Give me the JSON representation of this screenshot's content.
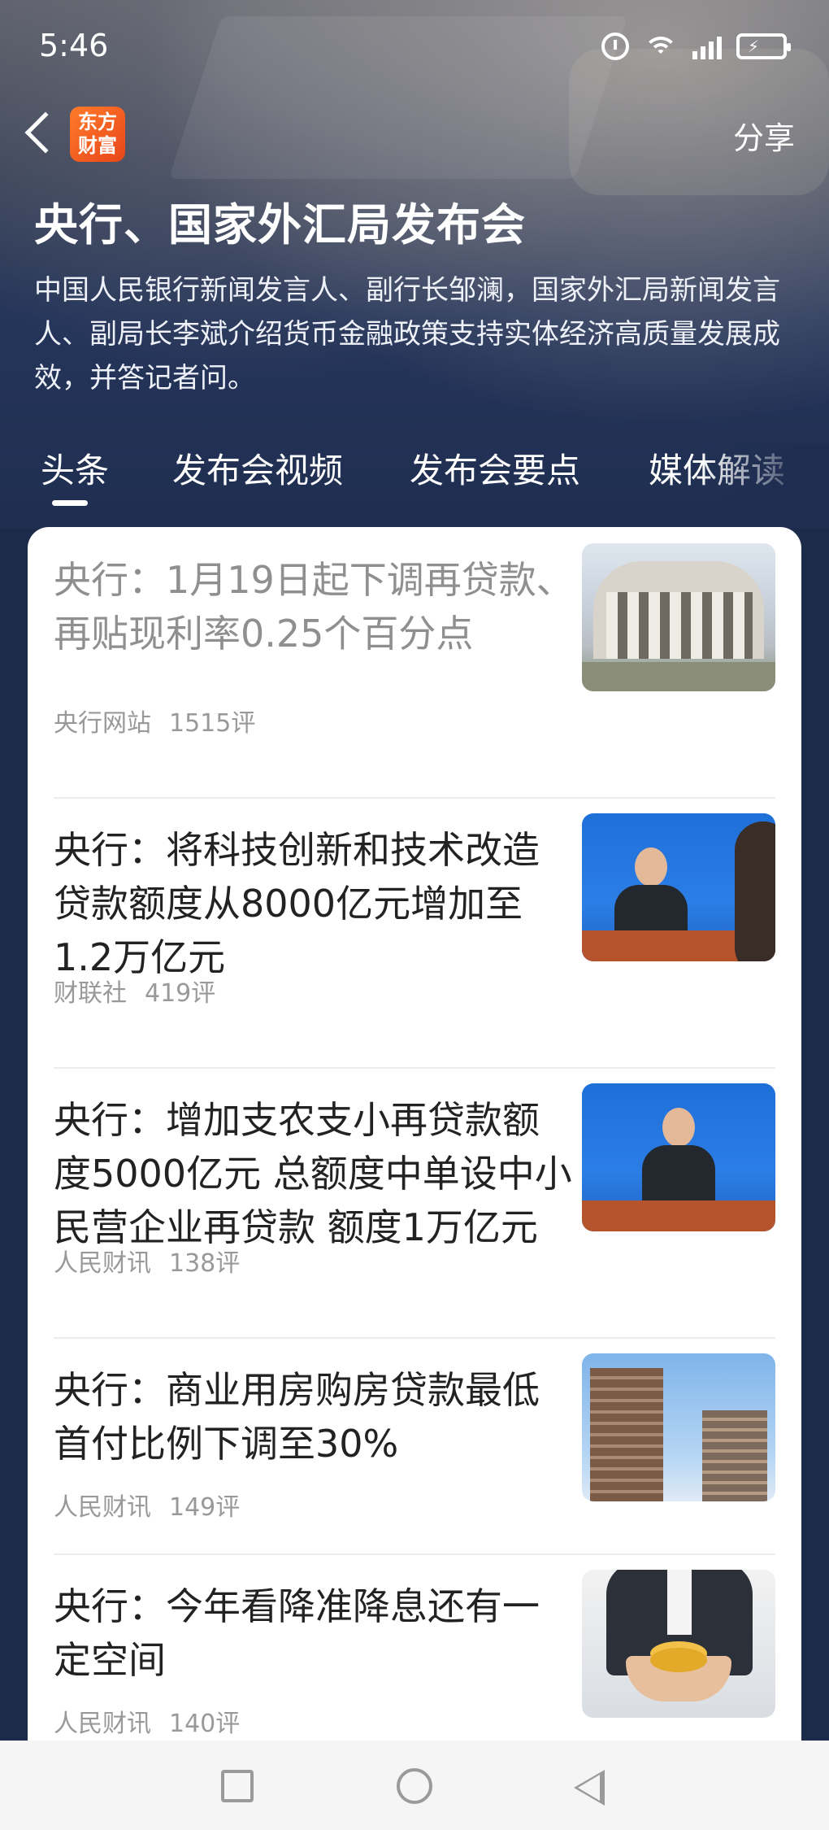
{
  "status_bar": {
    "time": "5:46"
  },
  "nav": {
    "logo_line1": "东方",
    "logo_line2": "财富",
    "share_label": "分享"
  },
  "header": {
    "title": "央行、国家外汇局发布会",
    "description": "中国人民银行新闻发言人、副行长邹澜，国家外汇局新闻发言人、副局长李斌介绍货币金融政策支持实体经济高质量发展成效，并答记者问。"
  },
  "tabs": [
    {
      "label": "头条",
      "active": true
    },
    {
      "label": "发布会视频"
    },
    {
      "label": "发布会要点"
    },
    {
      "label": "媒体解读"
    }
  ],
  "news": [
    {
      "title": "央行：1月19日起下调再贷款、再贴现利率0.25个百分点",
      "source": "央行网站",
      "comments": "1515评",
      "read": true,
      "thumb": "pboc-building-image"
    },
    {
      "title": "央行：将科技创新和技术改造贷款额度从8000亿元增加至1.2万亿元",
      "source": "财联社",
      "comments": "419评",
      "read": false,
      "thumb": "press-conference-image"
    },
    {
      "title": "央行：增加支农支小再贷款额度5000亿元 总额度中单设中小民营企业再贷款 额度1万亿元",
      "source": "人民财讯",
      "comments": "138评",
      "read": false,
      "thumb": "press-conference-image"
    },
    {
      "title": "央行：商业用房购房贷款最低首付比例下调至30%",
      "source": "人民财讯",
      "comments": "149评",
      "read": false,
      "thumb": "high-rise-buildings-image"
    },
    {
      "title": "央行：今年看降准降息还有一定空间",
      "source": "人民财讯",
      "comments": "140评",
      "read": false,
      "thumb": "coins-in-hands-image"
    }
  ]
}
